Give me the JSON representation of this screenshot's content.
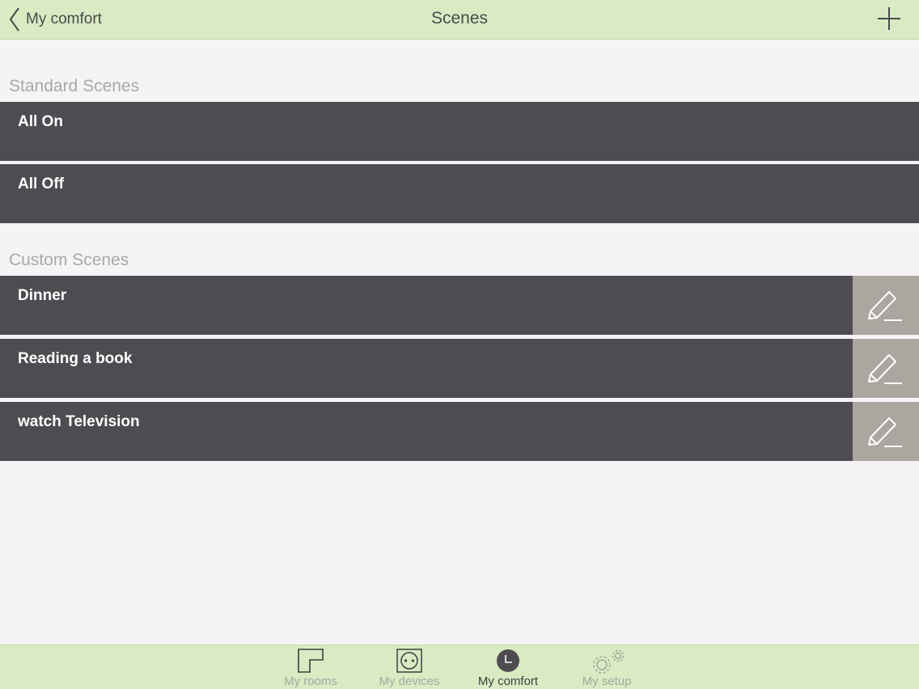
{
  "navbar": {
    "back_label": "My comfort",
    "title": "Scenes",
    "back_icon": "chevron-left-icon",
    "add_icon": "plus-icon"
  },
  "sections": {
    "standard": {
      "title": "Standard Scenes",
      "items": [
        {
          "label": "All On"
        },
        {
          "label": "All Off"
        }
      ]
    },
    "custom": {
      "title": "Custom Scenes",
      "items": [
        {
          "label": "Dinner",
          "edit_icon": "pencil-icon"
        },
        {
          "label": "Reading a book",
          "edit_icon": "pencil-icon"
        },
        {
          "label": "watch Television",
          "edit_icon": "pencil-icon"
        }
      ]
    }
  },
  "tabbar": {
    "tabs": [
      {
        "label": "My rooms",
        "icon": "floorplan-icon",
        "active": false
      },
      {
        "label": "My devices",
        "icon": "socket-icon",
        "active": false
      },
      {
        "label": "My comfort",
        "icon": "clock-icon",
        "active": true
      },
      {
        "label": "My setup",
        "icon": "gears-icon",
        "active": false
      }
    ]
  },
  "colors": {
    "bar_background": "#d8ebc3",
    "row_background": "#4e4c50",
    "edit_background": "#aca6a0",
    "page_background": "#f5f3f5"
  }
}
